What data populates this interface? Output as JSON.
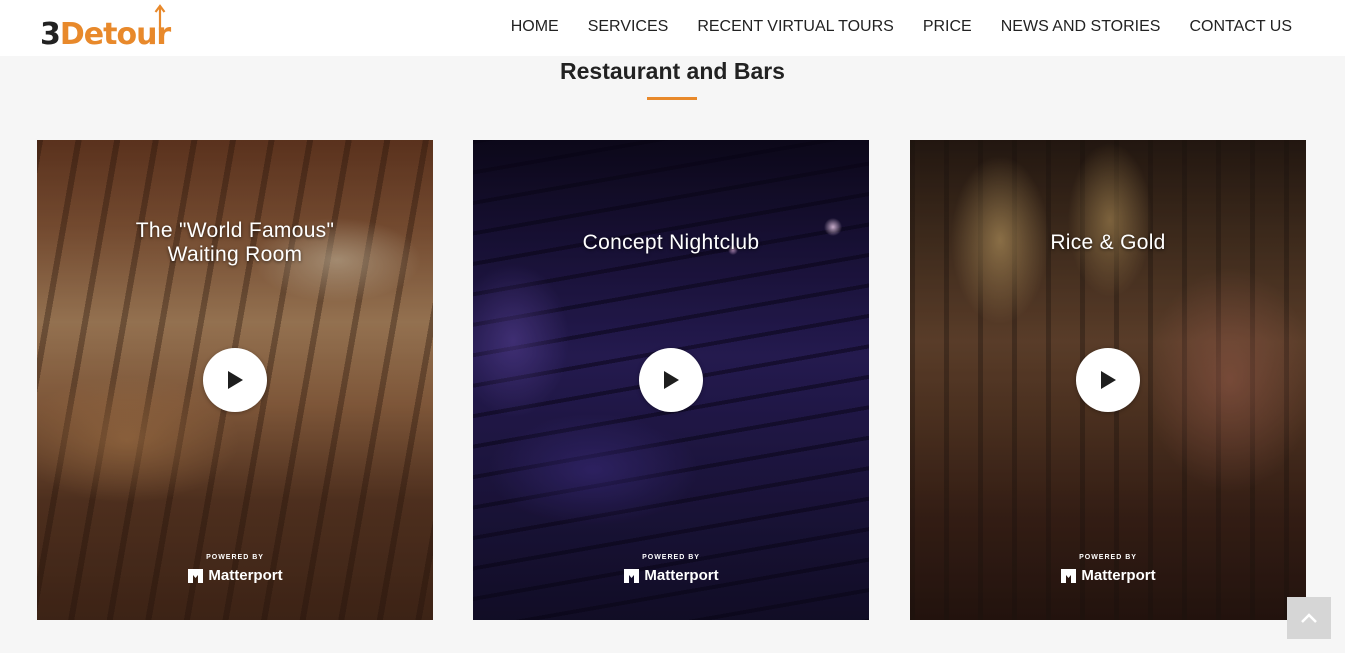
{
  "brand": {
    "logo_prefix": "3",
    "logo_word": "Detour",
    "accent_color": "#e8892b",
    "dark_color": "#222222"
  },
  "nav": {
    "items": [
      {
        "label": "HOME"
      },
      {
        "label": "SERVICES"
      },
      {
        "label": "RECENT VIRTUAL TOURS"
      },
      {
        "label": "PRICE"
      },
      {
        "label": "NEWS AND STORIES"
      },
      {
        "label": "CONTACT US"
      }
    ]
  },
  "section": {
    "title": "Restaurant and Bars"
  },
  "cards": [
    {
      "title_line1": "The \"World Famous\"",
      "title_line2": "Waiting Room",
      "powered_by": "POWERED BY",
      "provider": "Matterport",
      "play_icon": "play-icon"
    },
    {
      "title_line1": "Concept Nightclub",
      "powered_by": "POWERED BY",
      "provider": "Matterport",
      "play_icon": "play-icon"
    },
    {
      "title_line1": "Rice & Gold",
      "powered_by": "POWERED BY",
      "provider": "Matterport",
      "play_icon": "play-icon"
    }
  ],
  "scroll_top": {
    "icon": "chevron-up-icon"
  }
}
